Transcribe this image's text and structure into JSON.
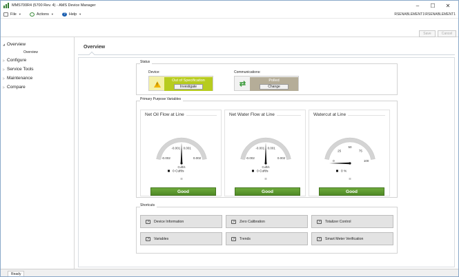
{
  "window": {
    "title": "MMS700R4 (5700 Rev. 4) - AMS Device Manager",
    "controls": {
      "minimize": "–",
      "maximize": "☐",
      "close": "✕"
    }
  },
  "menubar": {
    "file": "File",
    "actions": "Actions",
    "help": "Help",
    "user": "RSENABLEMENT1\\RSENABLEMENT1"
  },
  "toolbar": {
    "save": "Save",
    "cancel": "Cancel"
  },
  "sidebar": {
    "items": [
      {
        "label": "Overview",
        "expanded": true
      },
      {
        "label": "Configure"
      },
      {
        "label": "Service Tools"
      },
      {
        "label": "Maintenance"
      },
      {
        "label": "Compare"
      }
    ],
    "sub_overview": "Overview"
  },
  "main": {
    "tab": "Overview",
    "status": {
      "title": "Status",
      "device_label": "Device:",
      "device_status": "Out of Specification",
      "device_button": "Investigate",
      "comm_label": "Communications:",
      "comm_status": "Polled",
      "comm_button": "Change"
    },
    "ppv": {
      "title": "Primary Purpose Variables",
      "gauges": [
        {
          "title": "Net Oil Flow at Line",
          "ticks": [
            "-0.002",
            "-0.001",
            "0.001",
            "0.002"
          ],
          "unit": "Cuft/s",
          "value": "0",
          "value_unit": "Cuft/s",
          "status": "Good"
        },
        {
          "title": "Net Water Flow at Line",
          "ticks": [
            "-0.002",
            "-0.001",
            "0.001",
            "0.002"
          ],
          "unit": "Cuft/s",
          "value": "0",
          "value_unit": "Cuft/s",
          "status": "Good"
        },
        {
          "title": "Watercut at Line",
          "ticks": [
            "0",
            "25",
            "50",
            "75",
            "100"
          ],
          "unit": "",
          "value": "0",
          "value_unit": "%",
          "status": "Good"
        }
      ]
    },
    "shortcuts": {
      "title": "Shortcuts",
      "items": [
        "Device Information",
        "Zero Calibration",
        "Totalizer Control",
        "Variables",
        "Trends",
        "Smart Meter Verification"
      ]
    }
  },
  "statusbar": {
    "text": "Ready"
  },
  "colors": {
    "good": "#5a9a2e",
    "out_of_spec": "#b7cc1f",
    "polled": "#b5ad98",
    "warning": "#f0b400"
  }
}
